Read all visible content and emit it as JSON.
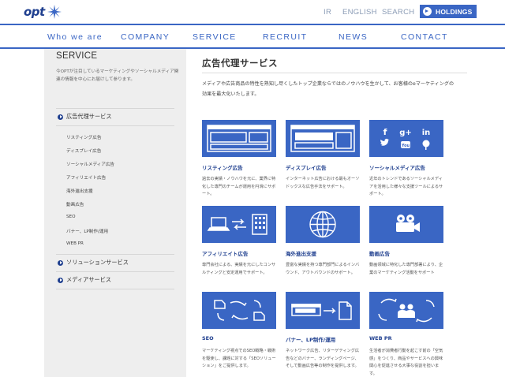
{
  "header": {
    "logo_text": "opt",
    "links": {
      "ir": "IR",
      "english": "ENGLISH",
      "search": "SEARCH"
    },
    "holdings_label": "HOLDINGS"
  },
  "nav": [
    "Who we are",
    "COMPANY",
    "SERVICE",
    "RECRUIT",
    "NEWS",
    "CONTACT"
  ],
  "sidebar": {
    "title": "SERVICE",
    "description": "今OPTが注目しているマーケティングやソーシャルメディア関連の情報を中心にお届けして参ります。",
    "section_ad": "広告代理サービス",
    "items": [
      "リスティング広告",
      "ディスプレイ広告",
      "ソーシャルメディア広告",
      "アフィリエイト広告",
      "海外進出支援",
      "動画広告",
      "SEO",
      "バナー、LP制作/運用",
      "WEB PR"
    ],
    "section_solution": "ソリューションサービス",
    "section_media": "メディアサービス"
  },
  "main": {
    "title": "広告代理サービス",
    "intro": "メディアや広告商品の特性を熟知し尽くしたトップ企業ならではのノウハウを生かして、お客様のeマーケティングの効果を最大化いたします。",
    "cards": [
      {
        "title": "リスティング広告",
        "desc": "過去の実績・ノウハウを元に、業界に特化した専門のチームが運用を円滑にサポート。",
        "icon": "listing-layout-icon"
      },
      {
        "title": "ディスプレイ広告",
        "desc": "インターネット広告における最もオーソドックスな広告手法をサポート。",
        "icon": "display-layout-icon"
      },
      {
        "title": "ソーシャルメディア広告",
        "desc": "近年のトレンドであるソーシャルメディアを活用した様々な支援ツールによるサポート。",
        "icon": "social-icons"
      },
      {
        "title": "アフィリエイト広告",
        "desc": "専門会社による、実績を元にしたコンサルティングと安定運用でサポート。",
        "icon": "affiliate-icon"
      },
      {
        "title": "海外進出支援",
        "desc": "豊富な実績を持つ専門部門によるインバウンド、アウトバウンドのサポート。",
        "icon": "globe-icon"
      },
      {
        "title": "動画広告",
        "desc": "動画領域に特化した専門部署により、企業のマーケティング活動をサポート",
        "icon": "video-camera-icon"
      },
      {
        "title": "SEO",
        "desc": "マーケティング視点でのSEO戦略・戦術を駆使し、課題に対する「SEOソリューション」をご提供します。",
        "icon": "seo-cycle-icon"
      },
      {
        "title": "バナー、LP制作/運用",
        "desc": "ネットワーク広告、リターゲティング広告などのバナー、ランディングページ、そして動画広告等の制作を提供します。",
        "icon": "banner-lp-icon"
      },
      {
        "title": "WEB PR",
        "desc": "生活者が消費者行動を起こす前の「空気感」をつくり、商品やサービスへの興味関心を促進させる大事な役割を担います。",
        "icon": "webpr-people-icon"
      }
    ]
  },
  "colors": {
    "brand": "#3a66c4",
    "brand_dark": "#1f3f8f",
    "sidebar_bg": "#eeeeee"
  }
}
